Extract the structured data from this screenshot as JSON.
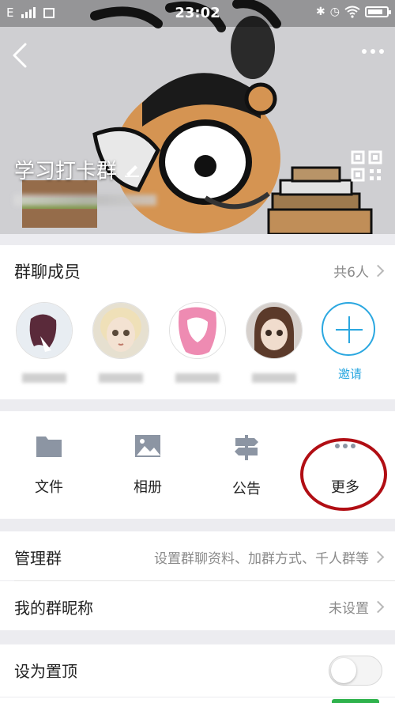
{
  "status_bar": {
    "carrier": "E",
    "time": "23:02",
    "bluetooth_icon": "bluetooth-icon",
    "alarm_icon": "alarm-icon",
    "wifi_icon": "wifi-icon"
  },
  "header": {
    "group_name": "学习打卡群",
    "edit_icon": "pencil-icon",
    "qr_icon": "qr-code-icon",
    "back_icon": "back-arrow-icon",
    "more_icon": "more-dots-icon"
  },
  "members": {
    "title": "群聊成员",
    "count_label": "共6人",
    "invite_label": "邀请"
  },
  "tools": [
    {
      "label": "文件",
      "icon": "folder-icon"
    },
    {
      "label": "相册",
      "icon": "image-icon"
    },
    {
      "label": "公告",
      "icon": "signpost-icon"
    },
    {
      "label": "更多",
      "icon": "more-dots-icon"
    }
  ],
  "settings": {
    "manage": {
      "label": "管理群",
      "value": "设置群聊资料、加群方式、千人群等"
    },
    "nickname": {
      "label": "我的群昵称",
      "value": "未设置"
    },
    "pin": {
      "label": "设为置顶",
      "on": false
    }
  },
  "colors": {
    "accent": "#2aa7e0",
    "highlight_ring": "#b10e14",
    "icon_gray": "#8c95a3"
  }
}
